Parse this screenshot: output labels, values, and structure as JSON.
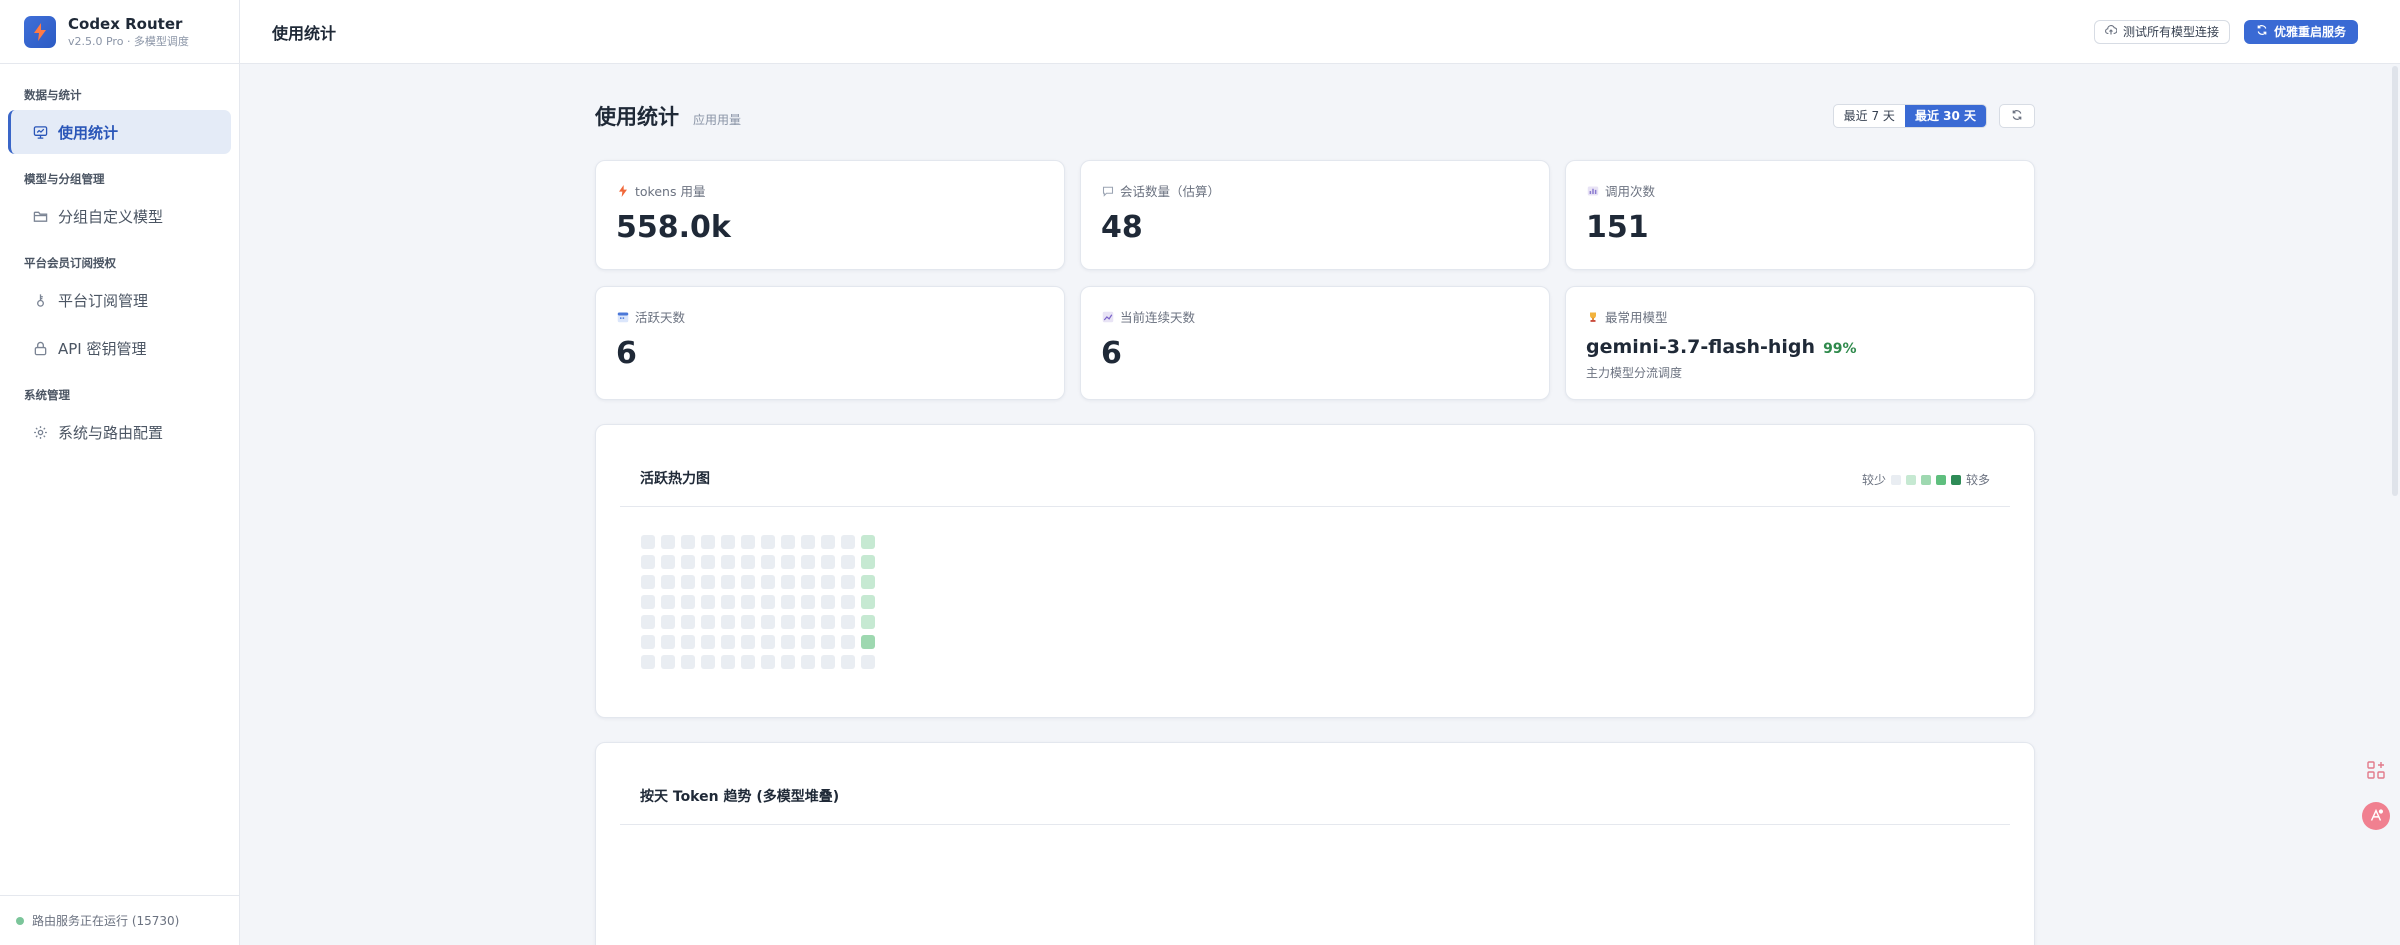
{
  "app": {
    "name": "Codex Router",
    "version": "v2.5.0 Pro · 多模型调度"
  },
  "sidebar": {
    "groups": [
      {
        "title": "数据与统计",
        "items": [
          {
            "label": "使用统计",
            "icon": "chart-icon",
            "active": true
          }
        ]
      },
      {
        "title": "模型与分组管理",
        "items": [
          {
            "label": "分组自定义模型",
            "icon": "folder-icon"
          }
        ]
      },
      {
        "title": "平台会员订阅授权",
        "items": [
          {
            "label": "平台订阅管理",
            "icon": "key-icon"
          },
          {
            "label": "API 密钥管理",
            "icon": "lock-icon"
          }
        ]
      },
      {
        "title": "系统管理",
        "items": [
          {
            "label": "系统与路由配置",
            "icon": "gear-icon"
          }
        ]
      }
    ],
    "footer": "路由服务正在运行 (15730)"
  },
  "topbar": {
    "title": "使用统计",
    "test_button": "测试所有模型连接",
    "restart_button": "优雅重启服务"
  },
  "page": {
    "title": "使用统计",
    "subtitle": "应用用量",
    "ranges": [
      "最近 7 天",
      "最近 30 天"
    ],
    "selected_range": "最近 30 天"
  },
  "stats": {
    "tokens": {
      "label": "tokens 用量",
      "value": "558.0k"
    },
    "sessions": {
      "label": "会话数量（估算）",
      "value": "48"
    },
    "calls": {
      "label": "调用次数",
      "value": "151"
    },
    "active_days": {
      "label": "活跃天数",
      "value": "6"
    },
    "streak": {
      "label": "当前连续天数",
      "value": "6"
    },
    "top_model": {
      "label": "最常用模型",
      "name": "gemini-3.7-flash-high",
      "pct": "99%",
      "note": "主力模型分流调度"
    }
  },
  "heatmap": {
    "title": "活跃热力图",
    "legend_less": "较少",
    "legend_more": "较多",
    "colors": [
      "#e9edf2",
      "#c6e9d2",
      "#9ed8b0",
      "#5fbf7e",
      "#2e8b57"
    ],
    "weeks": 12,
    "levels": [
      [
        0,
        0,
        0,
        0,
        0,
        0,
        0
      ],
      [
        0,
        0,
        0,
        0,
        0,
        0,
        0
      ],
      [
        0,
        0,
        0,
        0,
        0,
        0,
        0
      ],
      [
        0,
        0,
        0,
        0,
        0,
        0,
        0
      ],
      [
        0,
        0,
        0,
        0,
        0,
        0,
        0
      ],
      [
        0,
        0,
        0,
        0,
        0,
        0,
        0
      ],
      [
        0,
        0,
        0,
        0,
        0,
        0,
        0
      ],
      [
        0,
        0,
        0,
        0,
        0,
        0,
        0
      ],
      [
        0,
        0,
        0,
        0,
        0,
        0,
        0
      ],
      [
        0,
        0,
        0,
        0,
        0,
        0,
        0
      ],
      [
        0,
        0,
        0,
        0,
        0,
        0,
        0
      ],
      [
        1,
        1,
        1,
        1,
        1,
        2,
        0
      ]
    ]
  },
  "trend": {
    "title": "按天 Token 趋势 (多模型堆叠)"
  }
}
